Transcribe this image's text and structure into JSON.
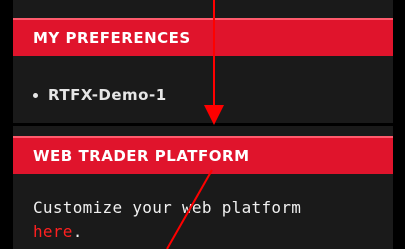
{
  "preferences": {
    "header": "MY PREFERENCES",
    "items": [
      {
        "label": "RTFX-Demo-1"
      }
    ]
  },
  "webtrader": {
    "header": "WEB TRADER PLATFORM",
    "body_text": "Customize your web platform",
    "link_label": "here",
    "trailing": "."
  },
  "colors": {
    "header_red": "#e0142c",
    "link_red": "#ff2020",
    "annotation_red": "#ff0000",
    "background": "#000000"
  }
}
